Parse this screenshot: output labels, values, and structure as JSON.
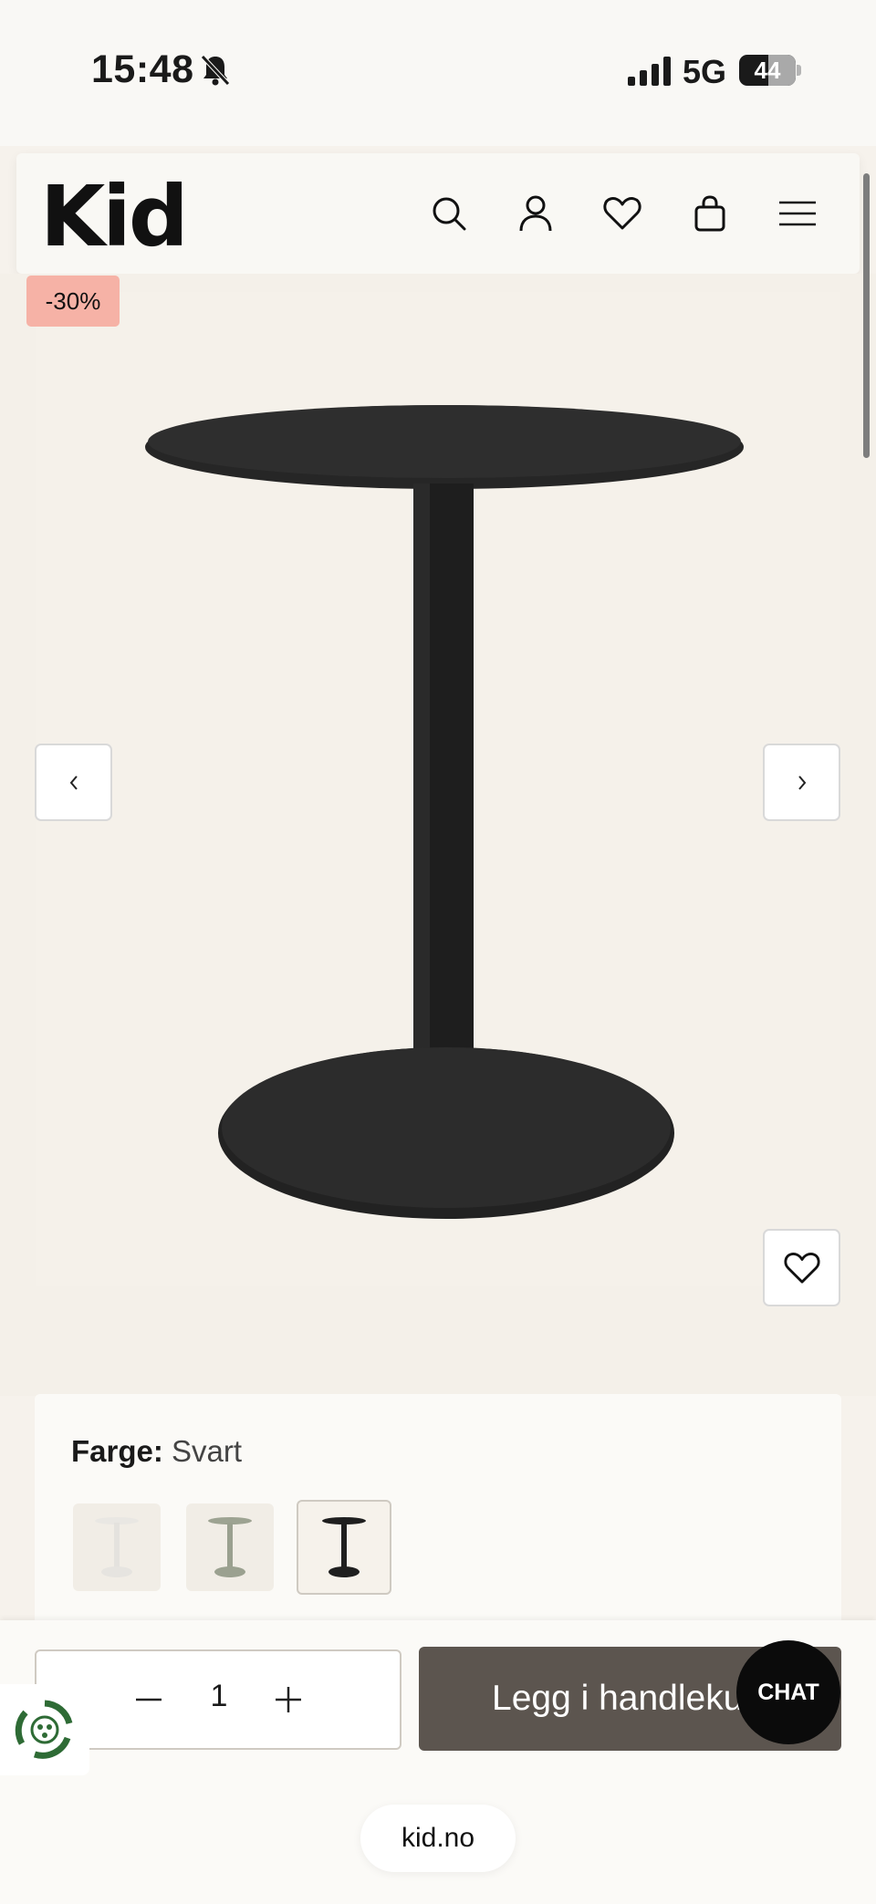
{
  "status_bar": {
    "time": "15:48",
    "network": "5G",
    "battery": "44",
    "icons": [
      "bell-muted-icon",
      "signal-icon",
      "battery-icon"
    ]
  },
  "header": {
    "logo": "Kid",
    "icons": [
      "search-icon",
      "account-icon",
      "wishlist-icon",
      "cart-icon",
      "menu-icon"
    ]
  },
  "product": {
    "discount_badge": "-30%",
    "image_icon": "round-pedestal-table-black",
    "gallery_icons": [
      "chevron-left-icon",
      "chevron-right-icon",
      "heart-icon"
    ]
  },
  "variants": {
    "label": "Farge:",
    "selected_value": "Svart",
    "swatches": [
      "table-white",
      "table-sage",
      "table-black"
    ],
    "selected_index": 2
  },
  "purchase": {
    "quantity": "1",
    "add_to_cart": "Legg i handlekurv",
    "chat": "CHAT"
  },
  "browser": {
    "url": "kid.no"
  },
  "colors": {
    "accent_button": "#5c554f",
    "badge": "#f6b2a6",
    "background": "#f4f0e9"
  }
}
